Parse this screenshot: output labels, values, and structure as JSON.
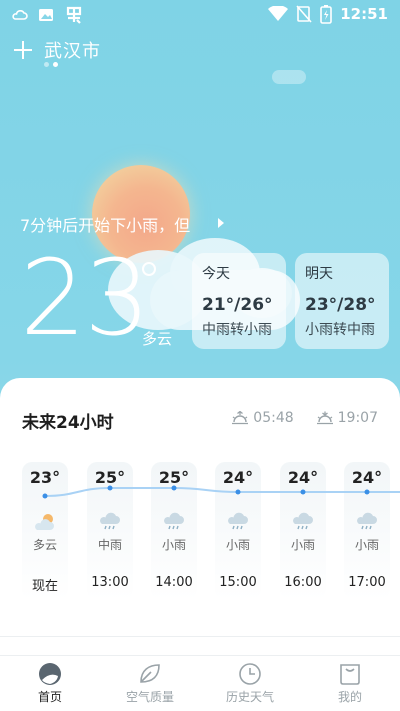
{
  "status_bar": {
    "time": "12:51"
  },
  "header": {
    "city": "武汉市",
    "page_count": 2,
    "active_page": 2
  },
  "alert": {
    "text": "7分钟后开始下小雨，但"
  },
  "current": {
    "temperature": "23",
    "condition": "多云"
  },
  "days": [
    {
      "label": "今天",
      "temp": "21°/26°",
      "condition": "中雨转小雨"
    },
    {
      "label": "明天",
      "temp": "23°/28°",
      "condition": "小雨转中雨"
    }
  ],
  "forecast24": {
    "title": "未来24小时",
    "sunrise": "05:48",
    "sunset": "19:07",
    "hours": [
      {
        "temp": "23°",
        "condition": "多云",
        "time": "现在",
        "icon": "cloudy-sun-icon"
      },
      {
        "temp": "25°",
        "condition": "中雨",
        "time": "13:00",
        "icon": "rain-icon"
      },
      {
        "temp": "25°",
        "condition": "小雨",
        "time": "14:00",
        "icon": "rain-icon"
      },
      {
        "temp": "24°",
        "condition": "小雨",
        "time": "15:00",
        "icon": "rain-icon"
      },
      {
        "temp": "24°",
        "condition": "小雨",
        "time": "16:00",
        "icon": "rain-icon"
      },
      {
        "temp": "24°",
        "condition": "小雨",
        "time": "17:00",
        "icon": "rain-icon"
      }
    ]
  },
  "nav": [
    {
      "label": "首页",
      "icon": "home-icon",
      "active": true
    },
    {
      "label": "空气质量",
      "icon": "leaf-icon",
      "active": false
    },
    {
      "label": "历史天气",
      "icon": "clock-icon",
      "active": false
    },
    {
      "label": "我的",
      "icon": "profile-icon",
      "active": false
    }
  ],
  "colors": {
    "sky": "#86d6e8",
    "accent_line": "#3b8fe6",
    "panel": "#ffffff"
  }
}
